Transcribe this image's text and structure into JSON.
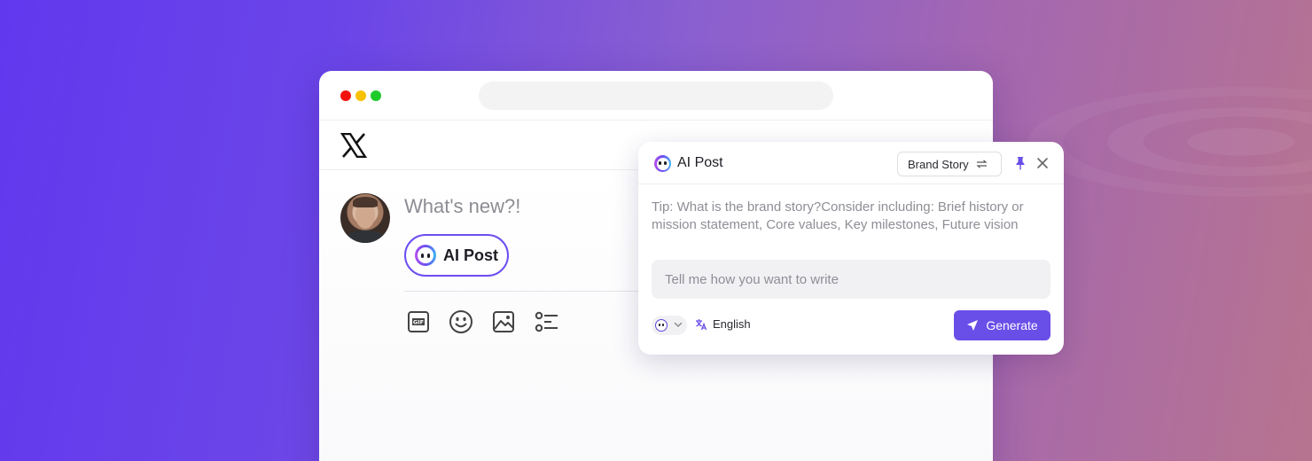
{
  "composer": {
    "placeholder": "What's new?!",
    "ai_post_label": "AI Post"
  },
  "toolbar": {
    "icons": [
      "gif-icon",
      "emoji-icon",
      "image-icon",
      "poll-icon"
    ]
  },
  "panel": {
    "title": "AI Post",
    "style_select": "Brand Story",
    "tip": "Tip: What is the brand story?Consider including: Brief history or mission statement, Core values, Key milestones, Future vision",
    "input_placeholder": "Tell me how you want to write",
    "language": "English",
    "generate_label": "Generate"
  },
  "colors": {
    "accent": "#6a4ee8",
    "dot_red": "#f2130f",
    "dot_yellow": "#f7c100",
    "dot_green": "#1ecb2a"
  }
}
